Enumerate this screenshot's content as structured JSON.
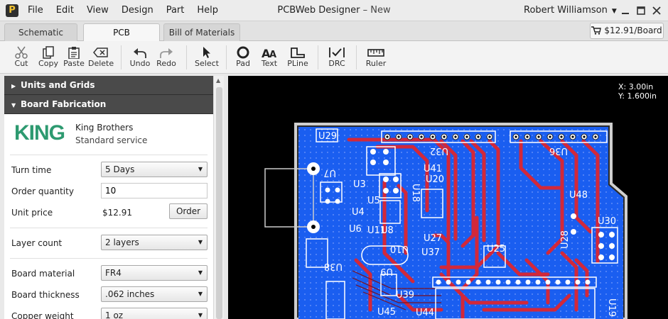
{
  "app": {
    "logo_letter": "P",
    "title": "PCBWeb Designer",
    "title_sep": " – ",
    "doc": "New",
    "user": "Robert Williamson"
  },
  "menu": [
    "File",
    "Edit",
    "View",
    "Design",
    "Part",
    "Help"
  ],
  "tabs": [
    {
      "label": "Schematic",
      "active": false
    },
    {
      "label": "PCB",
      "active": true
    },
    {
      "label": "Bill of Materials",
      "active": false
    }
  ],
  "price_button": "$12.91/Board",
  "toolbar": {
    "cut": "Cut",
    "copy": "Copy",
    "paste": "Paste",
    "delete": "Delete",
    "undo": "Undo",
    "redo": "Redo",
    "select": "Select",
    "pad": "Pad",
    "text": "Text",
    "pline": "PLine",
    "drc": "DRC",
    "ruler": "Ruler"
  },
  "panel": {
    "units_header": "Units and Grids",
    "fab_header": "Board Fabrication",
    "vendor_logo": "KING",
    "vendor_name": "King Brothers",
    "vendor_service": "Standard service",
    "turn_time_label": "Turn time",
    "turn_time_value": "5 Days",
    "order_qty_label": "Order quantity",
    "order_qty_value": "10",
    "unit_price_label": "Unit price",
    "unit_price_value": "$12.91",
    "order_button": "Order",
    "layer_count_label": "Layer count",
    "layer_count_value": "2 layers",
    "board_material_label": "Board material",
    "board_material_value": "FR4",
    "board_thickness_label": "Board thickness",
    "board_thickness_value": ".062 inches",
    "copper_weight_label": "Copper weight",
    "copper_weight_value": "1 oz"
  },
  "canvas": {
    "coord_x": "X: 3.00in",
    "coord_y": "Y: 1.600in",
    "ref_labels": [
      "U29",
      "U32",
      "U36",
      "U41",
      "U20",
      "U48",
      "U30",
      "U7",
      "U3",
      "U18",
      "U4",
      "U5",
      "U11",
      "U6",
      "U8",
      "U27",
      "U28",
      "U25",
      "U10",
      "U37",
      "U38",
      "U9",
      "U39",
      "U45",
      "U44",
      "U19"
    ],
    "colors": {
      "board": "#1a5ef0",
      "trace": "#d2283a",
      "silk": "#ffffff",
      "background": "#000000"
    }
  }
}
